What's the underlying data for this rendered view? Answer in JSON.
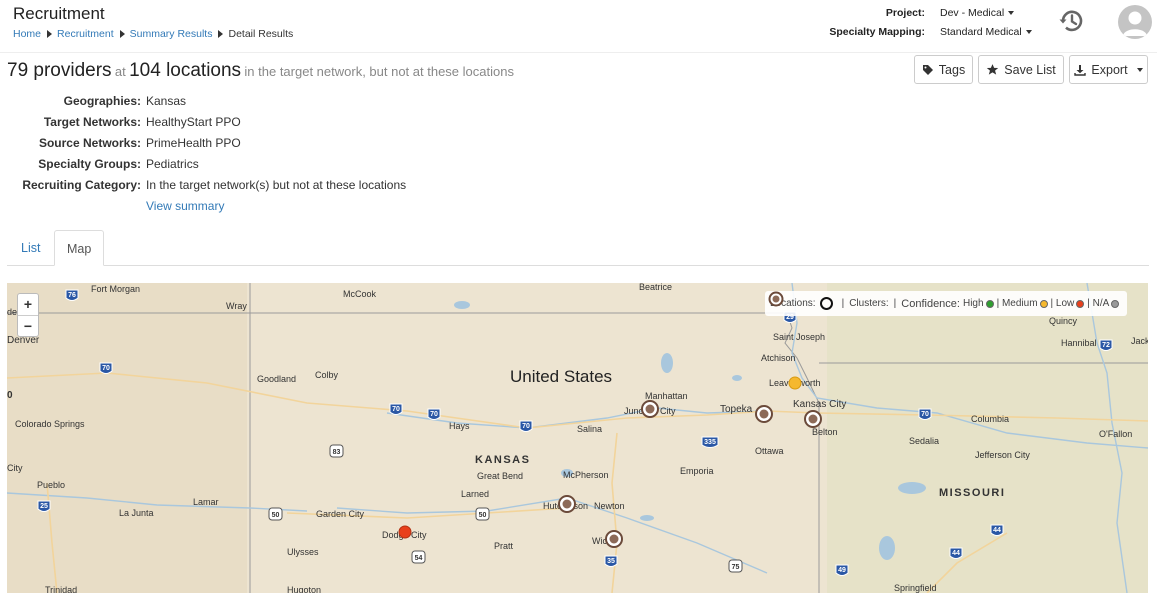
{
  "header": {
    "title": "Recruitment",
    "breadcrumb": [
      "Home",
      "Recruitment",
      "Summary Results",
      "Detail Results"
    ],
    "project_label": "Project:",
    "project_value": "Dev - Medical",
    "specialty_label": "Specialty Mapping:",
    "specialty_value": "Standard Medical"
  },
  "summary": {
    "provider_count": "79 providers",
    "at": "at",
    "location_count": "104 locations",
    "qualifier": "in the target network, but not at these locations",
    "facets": [
      {
        "label": "Geographies:",
        "value": "Kansas"
      },
      {
        "label": "Target Networks:",
        "value": "HealthyStart PPO"
      },
      {
        "label": "Source Networks:",
        "value": "PrimeHealth PPO"
      },
      {
        "label": "Specialty Groups:",
        "value": "Pediatrics"
      },
      {
        "label": "Recruiting Category:",
        "value": "In the target network(s) but not at these locations"
      }
    ],
    "view_summary": "View summary"
  },
  "toolbar": {
    "tags_label": "Tags",
    "save_label": "Save List",
    "export_label": "Export"
  },
  "tabs": [
    {
      "label": "List",
      "active": false
    },
    {
      "label": "Map",
      "active": true
    }
  ],
  "map": {
    "zoom_in": "+",
    "zoom_out": "−",
    "legend": {
      "locations": "Locations:",
      "clusters": "Clusters:",
      "confidence": "Confidence:",
      "high": "High",
      "medium": "Medium",
      "low": "Low",
      "na": "N/A"
    },
    "legend_colors": {
      "high": "#2e9e2e",
      "medium": "#f5b82e",
      "low": "#e8401c",
      "na": "#999999"
    },
    "country_label": "United States",
    "state_labels": [
      "KANSAS",
      "MISSOURI"
    ],
    "places": [
      "Fort Morgan",
      "Wray",
      "McCook",
      "Beatrice",
      "Denver",
      "Quincy",
      "Hannibal",
      "Jack",
      "Saint Joseph",
      "Atchison",
      "Leavenworth",
      "Goodland",
      "Colby",
      "Manhattan",
      "Junction City",
      "Topeka",
      "Kansas City",
      "Belton",
      "Columbia",
      "Colorado Springs",
      "Hays",
      "Salina",
      "Sedalia",
      "O'Fallon",
      "Ottawa",
      "Jefferson City",
      "Great Bend",
      "McPherson",
      "Emporia",
      "Pueblo",
      "Larned",
      "Hutchinson",
      "Newton",
      "Lamar",
      "La Junta",
      "Garden City",
      "Dodge City",
      "Pratt",
      "Wichita",
      "Ulysses",
      "Springfield",
      "Trinidad",
      "Hugoton",
      "City",
      "de",
      "0"
    ],
    "highways": [
      "76",
      "70",
      "70",
      "70",
      "70",
      "335",
      "70",
      "83",
      "25",
      "50",
      "50",
      "54",
      "35",
      "75",
      "49",
      "44",
      "44",
      "72",
      "29"
    ]
  }
}
